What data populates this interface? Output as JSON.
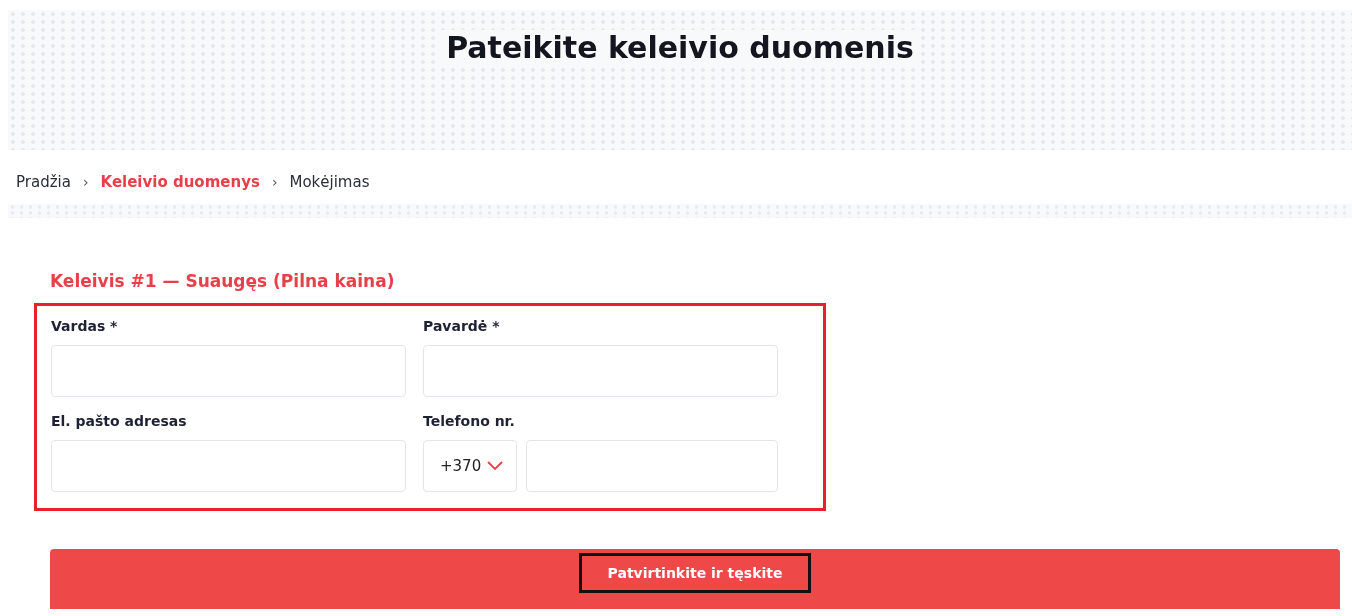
{
  "header": {
    "title": "Pateikite keleivio duomenis"
  },
  "breadcrumbs": [
    {
      "label": "Pradžia",
      "selected": false
    },
    {
      "label": "Keleivio duomenys",
      "selected": true
    },
    {
      "label": "Mokėjimas",
      "selected": false
    }
  ],
  "breadcrumb_separator": "›",
  "passenger": {
    "heading": "Keleivis #1 — Suaugęs (Pilna kaina)",
    "highlighted": true,
    "fields": [
      {
        "kind": "text",
        "label": "Vardas *"
      },
      {
        "kind": "text",
        "label": "Pavardė *"
      },
      {
        "kind": "text",
        "label": "El. pašto adresas"
      },
      {
        "kind": "phone",
        "label": "Telefono nr.",
        "code": "+370"
      }
    ]
  },
  "submit": {
    "label": "Patvirtinkite ir tęskite",
    "highlighted": true
  }
}
